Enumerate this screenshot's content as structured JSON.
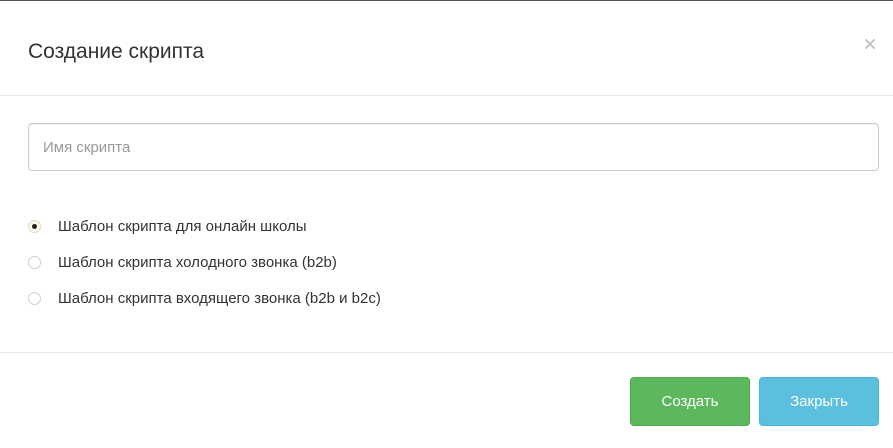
{
  "modal": {
    "title": "Создание скрипта",
    "close_icon": "close-icon"
  },
  "form": {
    "name_input": {
      "value": "",
      "placeholder": "Имя скрипта"
    },
    "templates": [
      {
        "label": "Шаблон скрипта для онлайн школы",
        "checked": true
      },
      {
        "label": "Шаблон скрипта холодного звонка (b2b)",
        "checked": false
      },
      {
        "label": "Шаблон скрипта входящего звонка (b2b и b2c)",
        "checked": false
      }
    ]
  },
  "footer": {
    "create_label": "Создать",
    "close_label": "Закрыть"
  },
  "colors": {
    "create_button": "#5cb85c",
    "close_button": "#5bc0de",
    "divider": "#e5e5e5"
  }
}
